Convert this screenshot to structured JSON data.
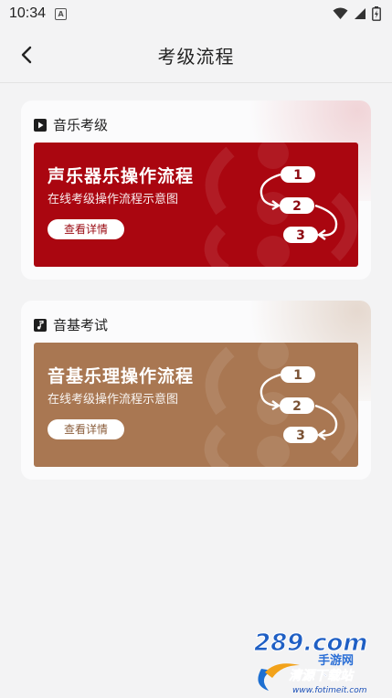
{
  "status": {
    "time": "10:34",
    "app_glyph": "A"
  },
  "header": {
    "title": "考级流程"
  },
  "sections": [
    {
      "title": "音乐考级",
      "card": {
        "title": "声乐器乐操作流程",
        "subtitle": "在线考级操作流程示意图",
        "button": "查看详情",
        "steps": [
          "1",
          "2",
          "3"
        ]
      }
    },
    {
      "title": "音基考试",
      "card": {
        "title": "音基乐理操作流程",
        "subtitle": "在线考级操作流程示意图",
        "button": "查看详情",
        "steps": [
          "1",
          "2",
          "3"
        ]
      }
    }
  ],
  "watermark": {
    "brand": "289.com",
    "sub1": "手游网",
    "sub2": "清源下载站",
    "url": "www.fotimeit.com"
  },
  "colors": {
    "card_red": "#aa0610",
    "card_brown": "#a97752"
  }
}
